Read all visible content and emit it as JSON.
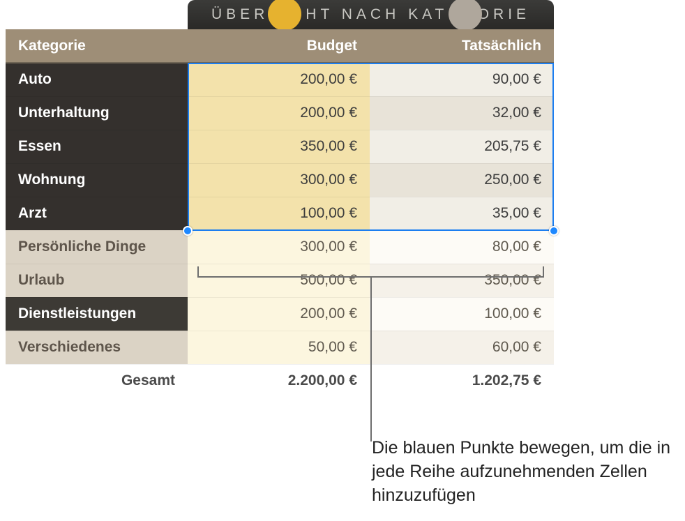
{
  "title": "ÜBERSICHT NACH KATEGORIE",
  "headers": {
    "category": "Kategorie",
    "budget": "Budget",
    "actual": "Tatsächlich"
  },
  "rows": [
    {
      "cat": "Auto",
      "budget": "200,00 €",
      "actual": "90,00 €"
    },
    {
      "cat": "Unterhaltung",
      "budget": "200,00 €",
      "actual": "32,00 €"
    },
    {
      "cat": "Essen",
      "budget": "350,00 €",
      "actual": "205,75 €"
    },
    {
      "cat": "Wohnung",
      "budget": "300,00 €",
      "actual": "250,00 €"
    },
    {
      "cat": "Arzt",
      "budget": "100,00 €",
      "actual": "35,00 €"
    },
    {
      "cat": "Persönliche Dinge",
      "budget": "300,00 €",
      "actual": "80,00 €"
    },
    {
      "cat": "Urlaub",
      "budget": "500,00 €",
      "actual": "350,00 €"
    },
    {
      "cat": "Dienstleistungen",
      "budget": "200,00 €",
      "actual": "100,00 €"
    },
    {
      "cat": "Verschiedenes",
      "budget": "50,00 €",
      "actual": "60,00 €"
    }
  ],
  "total": {
    "label": "Gesamt",
    "budget": "2.200,00 €",
    "actual": "1.202,75 €"
  },
  "annotation": "Die blauen Punkte bewegen, um die in jede Reihe aufzunehmenden Zellen hinzuzufügen"
}
